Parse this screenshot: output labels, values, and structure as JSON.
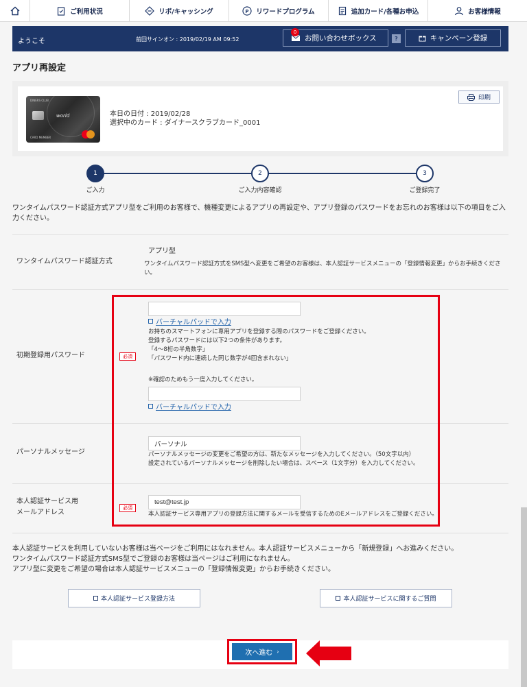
{
  "nav": {
    "items": [
      {
        "label": "ご利用状況",
        "icon": "clipboard-check-icon"
      },
      {
        "label": "リボ/キャッシング",
        "icon": "diamond-arrows-icon"
      },
      {
        "label": "リワードプログラム",
        "icon": "points-icon"
      },
      {
        "label": "追加カード/各種お申込",
        "icon": "document-icon"
      },
      {
        "label": "お客様情報",
        "icon": "user-icon"
      }
    ]
  },
  "welcome": {
    "hello": "ようこそ",
    "last_signin": "前回サインオン : 2019/02/19 AM 09:52",
    "inquiry_label": "お問い合わせボックス",
    "inquiry_count": "0",
    "help": "?",
    "campaign_label": "キャンペーン登録"
  },
  "page": {
    "title": "アプリ再設定"
  },
  "card": {
    "date_line": "本日の日付 : 2019/02/28",
    "selected_line": "選択中のカード : ダイナースクラブカード_0001",
    "print_label": "印刷",
    "face_brand": "DINERS CLUB",
    "face_world": "world",
    "face_member": "CARD MEMBER"
  },
  "steps": [
    {
      "num": "1",
      "label": "ご入力"
    },
    {
      "num": "2",
      "label": "ご入力内容確認"
    },
    {
      "num": "3",
      "label": "ご登録完了"
    }
  ],
  "intro": "ワンタイムパスワード認証方式アプリ型をご利用のお客様で、機種変更によるアプリの再設定や、アプリ登録のパスワードをお忘れのお客様は以下の項目をご入力ください。",
  "form": {
    "method": {
      "label": "ワンタイムパスワード認証方式",
      "value": "アプリ型",
      "note": "ワンタイムパスワード認証方式をSMS型へ変更をご希望のお客様は、本人認証サービスメニューの「登録情報変更」からお手続きください。"
    },
    "password": {
      "label": "初期登録用パスワード",
      "required": "必須",
      "value": "",
      "confirm_value": "",
      "vpad_label": "バーチャルパッドで入力",
      "help_lines": [
        "お持ちのスマートフォンに専用アプリを登録する際のパスワードをご登録ください。",
        "登録するパスワードには以下2つの条件があります。",
        "「4～8桁の半角数字」",
        "「パスワード内に連続した同じ数字が4回含まれない」"
      ],
      "confirm_note": "※確認のためもう一度入力してください。"
    },
    "message": {
      "label": "パーソナルメッセージ",
      "value": "パーソナル",
      "help_lines": [
        "パーソナルメッセージの変更をご希望の方は、新たなメッセージを入力してください。（50文字以内）",
        "設定されているパーソナルメッセージを削除したい場合は、スペース（1文字分）を入力してください。"
      ]
    },
    "email": {
      "label_line1": "本人認証サービス用",
      "label_line2": "メールアドレス",
      "required": "必須",
      "value": "test@test.jp",
      "help": "本人認証サービス専用アプリの登録方法に関するメールを受信するためのEメールアドレスをご登録ください。"
    }
  },
  "notes": [
    "本人認証サービスを利用していないお客様は当ページをご利用にはなれません。本人認証サービスメニューから「新規登録」へお進みください。",
    "ワンタイムパスワード認証方式SMS型でご登録のお客様は当ページはご利用になれません。",
    "アプリ型に変更をご希望の場合は本人認証サービスメニューの「登録情報変更」からお手続きください。"
  ],
  "links": {
    "register_method": "本人認証サービス登録方法",
    "faq": "本人認証サービスに関するご質問"
  },
  "next_label": "次へ進む",
  "colors": {
    "navy": "#1d3668",
    "accent_blue": "#1f6fb0",
    "highlight_red": "#e60012"
  }
}
